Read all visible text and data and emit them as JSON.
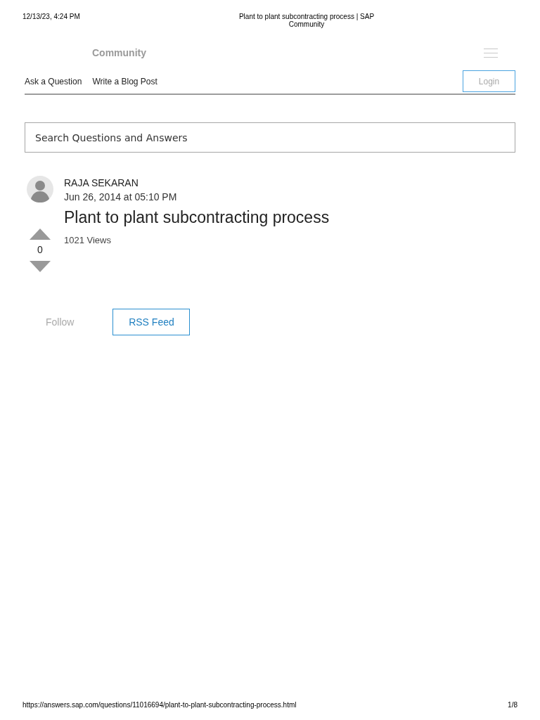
{
  "print_header": {
    "date": "12/13/23, 4:24 PM",
    "title": "Plant to plant subcontracting process | SAP Community"
  },
  "site": {
    "name": "Community"
  },
  "nav": {
    "links": [
      "Ask a Question",
      "Write a Blog Post"
    ],
    "login": "Login"
  },
  "search": {
    "placeholder": "Search Questions and Answers"
  },
  "question": {
    "author": "RAJA SEKARAN",
    "date": "Jun 26, 2014 at 05:10 PM",
    "title": "Plant to plant subcontracting process",
    "votes": "0",
    "views": "1021 Views"
  },
  "actions": [
    {
      "label": "Follow",
      "kind": "link"
    },
    {
      "label": "RSS Feed",
      "kind": "outlined"
    }
  ],
  "print_footer": {
    "url": "https://answers.sap.com/questions/11016694/plant-to-plant-subcontracting-process.html",
    "page": "1/8"
  }
}
